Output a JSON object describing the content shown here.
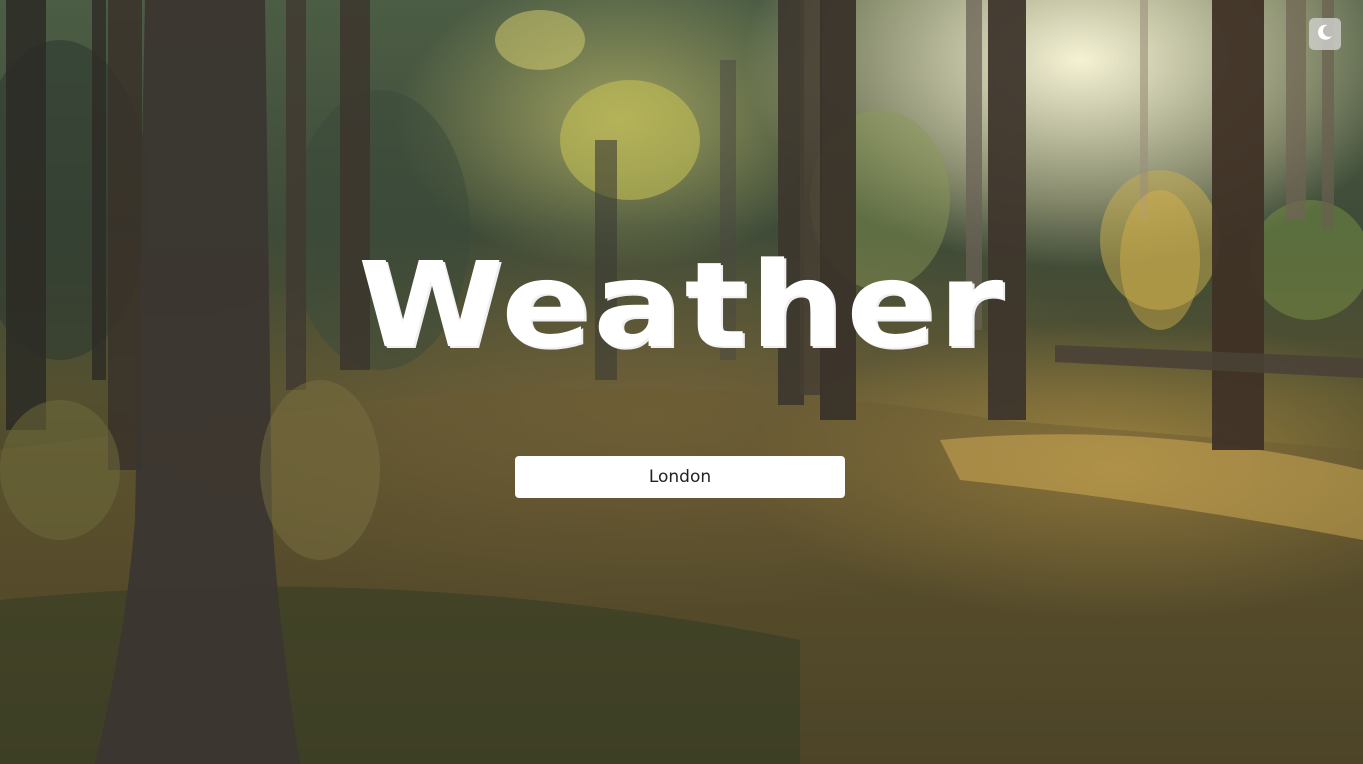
{
  "page": {
    "title": "Weather"
  },
  "search": {
    "value": "London",
    "placeholder": ""
  },
  "theme_toggle": {
    "icon": "moon-icon",
    "mode": "dark"
  },
  "background": {
    "icon": "forest-background-image"
  },
  "colors": {
    "title_text": "#ffffff",
    "input_background": "#ffffff",
    "toggle_background": "#cdcdc8"
  }
}
